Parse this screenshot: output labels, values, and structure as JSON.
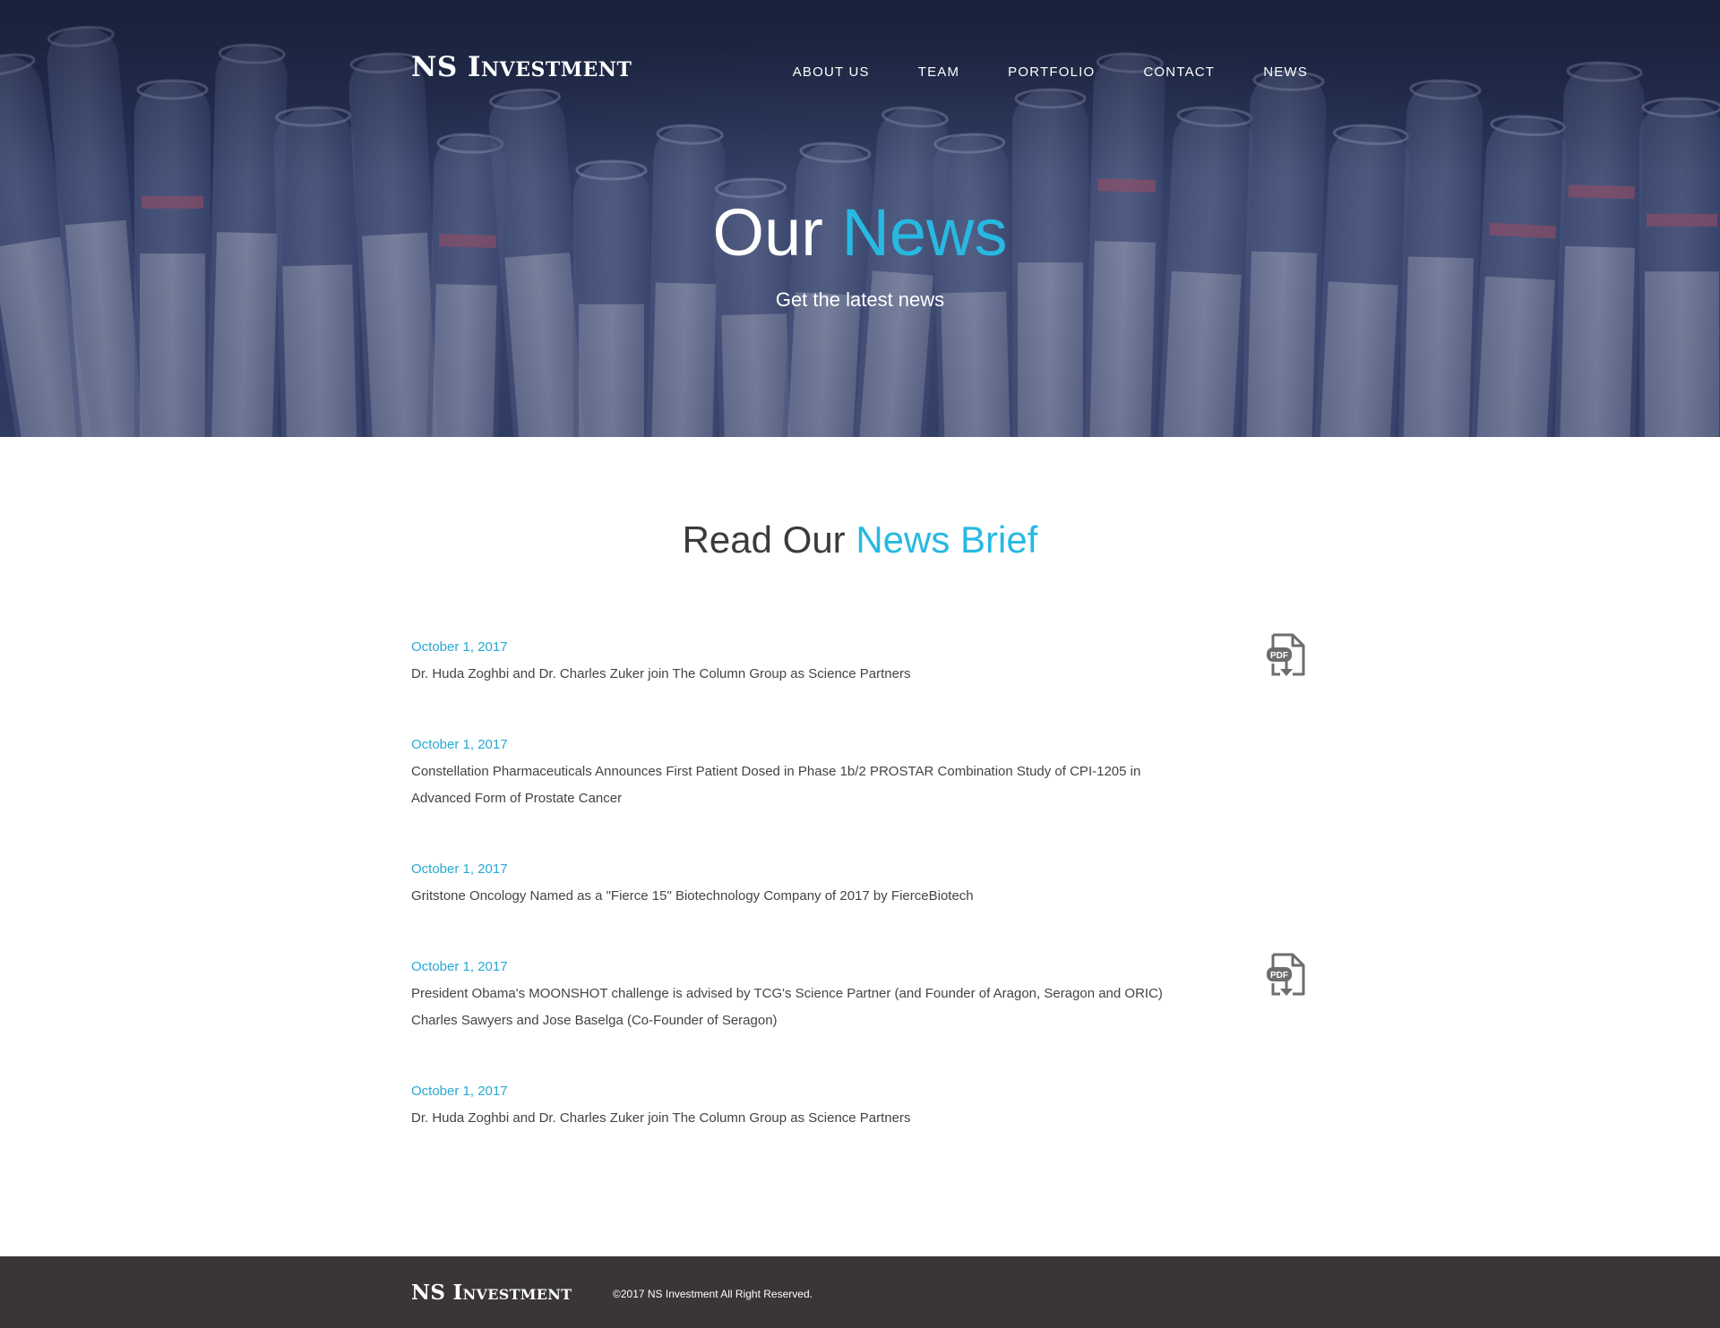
{
  "header": {
    "logo": "NS Investment",
    "nav": [
      {
        "label": "ABOUT US"
      },
      {
        "label": "TEAM"
      },
      {
        "label": "PORTFOLIO"
      },
      {
        "label": "CONTACT"
      },
      {
        "label": "NEWS"
      }
    ]
  },
  "hero": {
    "title_plain": "Our",
    "title_accent": "News",
    "subtitle": "Get the latest news"
  },
  "section": {
    "title_plain": "Read Our",
    "title_accent": "News Brief"
  },
  "news": [
    {
      "date": "October 1, 2017",
      "headline": "Dr. Huda Zoghbi and Dr. Charles Zuker join The Column Group as Science Partners",
      "has_pdf": true
    },
    {
      "date": "October 1, 2017",
      "headline": "Constellation Pharmaceuticals Announces First Patient Dosed in Phase 1b/2 PROSTAR Combination Study of CPI-1205 in Advanced Form of Prostate Cancer",
      "has_pdf": false
    },
    {
      "date": "October 1, 2017",
      "headline": "Gritstone Oncology Named as a \"Fierce 15\" Biotechnology Company of 2017 by FierceBiotech",
      "has_pdf": false
    },
    {
      "date": "October 1, 2017",
      "headline": "President Obama's MOONSHOT challenge is advised by TCG's Science Partner (and Founder of Aragon, Seragon and ORIC) Charles Sawyers and Jose Baselga (Co-Founder of Seragon)",
      "has_pdf": true
    },
    {
      "date": "October 1, 2017",
      "headline": "Dr. Huda Zoghbi and Dr. Charles Zuker join The Column Group as Science Partners",
      "has_pdf": false
    }
  ],
  "pdf_icon": {
    "name": "pdf-download-icon",
    "badge": "PDF"
  },
  "footer": {
    "logo": "NS Investment",
    "copyright": "©2017 NS Investment All Right Reserved."
  },
  "colors": {
    "accent": "#27b9e2",
    "date": "#27a9d3",
    "footer_bg": "#3a3636",
    "body_text": "#444444"
  }
}
